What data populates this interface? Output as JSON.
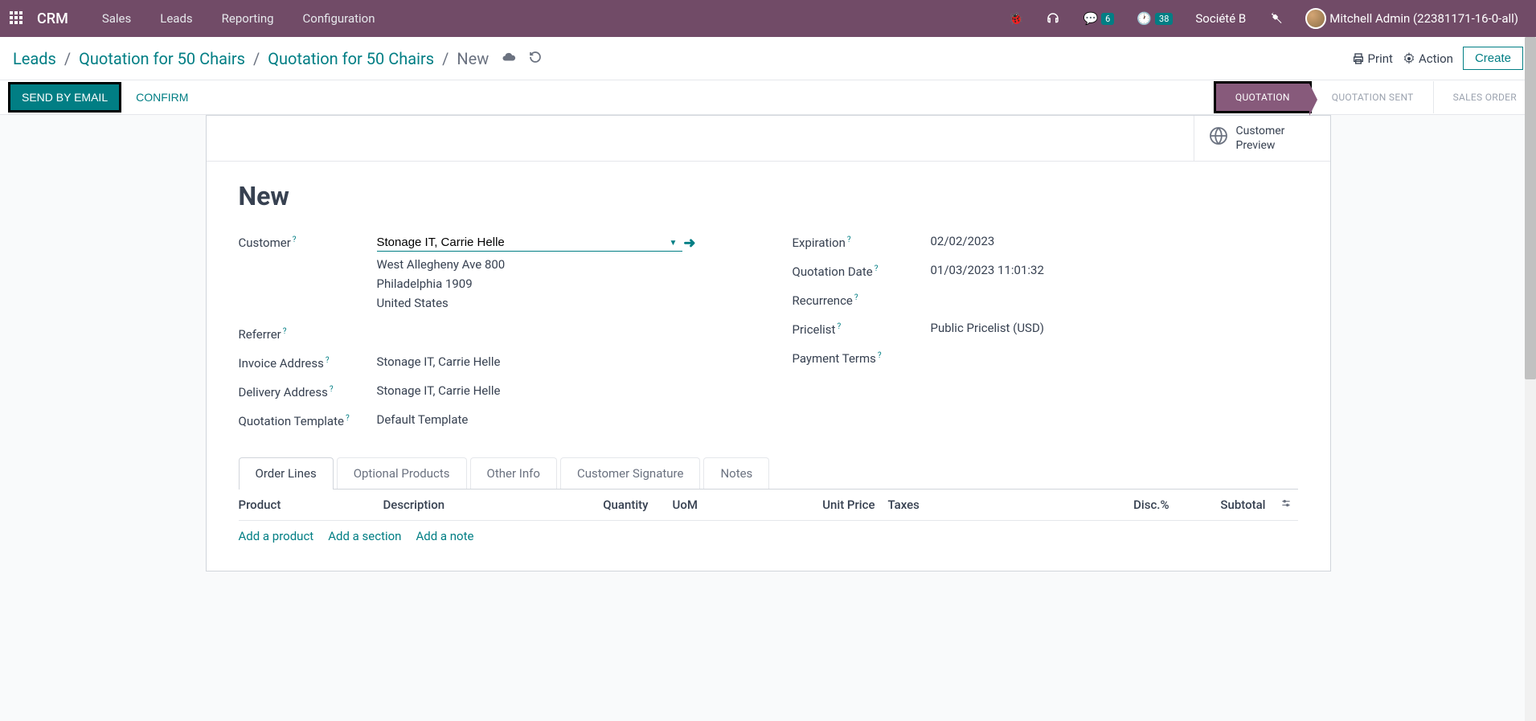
{
  "topbar": {
    "brand": "CRM",
    "nav": [
      "Sales",
      "Leads",
      "Reporting",
      "Configuration"
    ],
    "chat_badge": "6",
    "activity_badge": "38",
    "company": "Société B",
    "user": "Mitchell Admin (22381171-16-0-all)"
  },
  "breadcrumb": {
    "items": [
      "Leads",
      "Quotation for 50 Chairs",
      "Quotation for 50 Chairs"
    ],
    "current": "New",
    "print": "Print",
    "action": "Action",
    "create": "Create"
  },
  "status_bar": {
    "send_email": "SEND BY EMAIL",
    "confirm": "CONFIRM",
    "stages": [
      "QUOTATION",
      "QUOTATION SENT",
      "SALES ORDER"
    ]
  },
  "stat": {
    "customer_preview_1": "Customer",
    "customer_preview_2": "Preview"
  },
  "form": {
    "title": "New",
    "customer_label": "Customer",
    "customer_value": "Stonage IT, Carrie Helle",
    "address_1": "West Allegheny Ave 800",
    "address_2": "Philadelphia 1909",
    "address_3": "United States",
    "referrer_label": "Referrer",
    "invoice_label": "Invoice Address",
    "invoice_value": "Stonage IT, Carrie Helle",
    "delivery_label": "Delivery Address",
    "delivery_value": "Stonage IT, Carrie Helle",
    "template_label": "Quotation Template",
    "template_value": "Default Template",
    "expiration_label": "Expiration",
    "expiration_value": "02/02/2023",
    "quotation_date_label": "Quotation Date",
    "quotation_date_value": "01/03/2023 11:01:32",
    "recurrence_label": "Recurrence",
    "pricelist_label": "Pricelist",
    "pricelist_value": "Public Pricelist (USD)",
    "payment_terms_label": "Payment Terms"
  },
  "tabs": [
    "Order Lines",
    "Optional Products",
    "Other Info",
    "Customer Signature",
    "Notes"
  ],
  "table": {
    "product": "Product",
    "description": "Description",
    "quantity": "Quantity",
    "uom": "UoM",
    "unit_price": "Unit Price",
    "taxes": "Taxes",
    "disc": "Disc.%",
    "subtotal": "Subtotal"
  },
  "add_links": {
    "product": "Add a product",
    "section": "Add a section",
    "note": "Add a note"
  }
}
